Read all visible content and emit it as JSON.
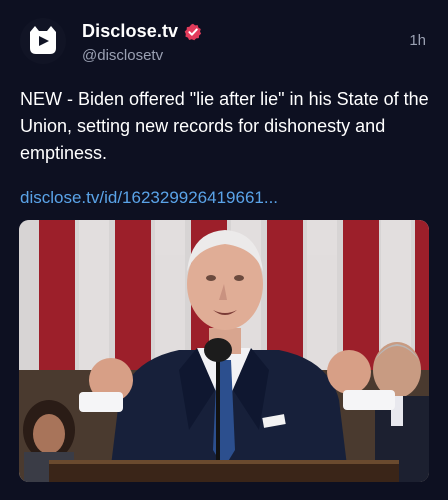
{
  "account": {
    "name": "Disclose.tv",
    "handle": "@disclosetv",
    "time": "1h"
  },
  "post": {
    "text": "NEW - Biden offered \"lie after lie\" in his State of the Union, setting new records for dishonesty and emptiness.",
    "link": "disclose.tv/id/162329926419661..."
  },
  "icons": {
    "avatar": "disclose-tv-logo",
    "verified": "verified-badge-icon"
  },
  "colors": {
    "background": "#0d1021",
    "link": "#5aa3e8",
    "verified": "#e23b5b",
    "secondary_text": "#9aa0b2"
  }
}
